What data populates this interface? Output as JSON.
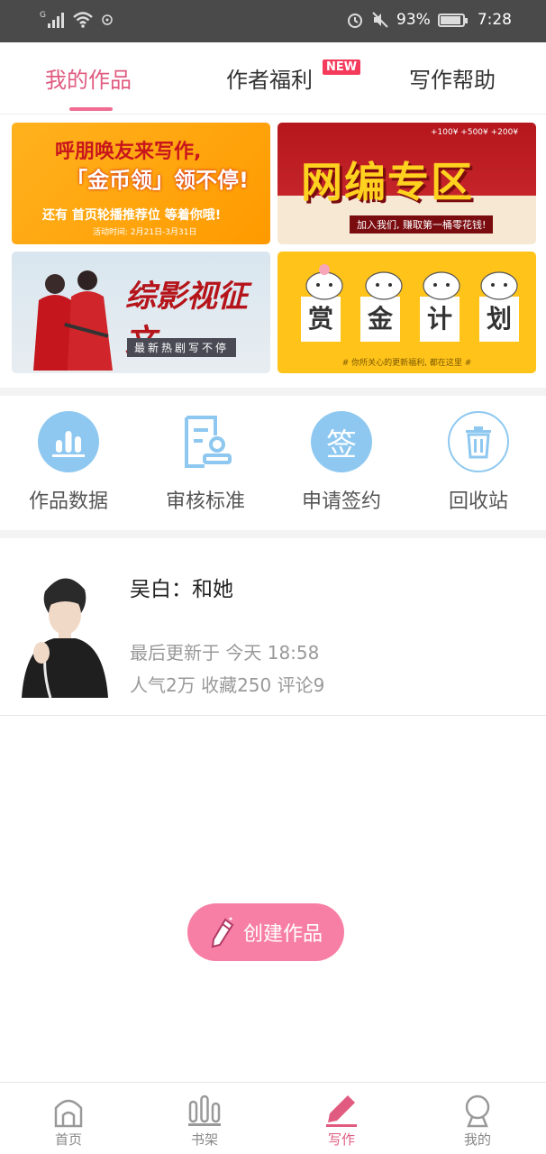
{
  "status_bar": {
    "network": "G",
    "battery": "93%",
    "time": "7:28"
  },
  "tabs": [
    {
      "label": "我的作品",
      "active": true
    },
    {
      "label": "作者福利",
      "badge": "NEW"
    },
    {
      "label": "写作帮助"
    }
  ],
  "banners": {
    "b1": {
      "line1": "呼朋唤友来写作,",
      "line2": "「金币领」领不停!",
      "line3": "还有 首页轮播推荐位 等着你哦!",
      "line4": "活动时间: 2月21日-3月31日"
    },
    "b2": {
      "title": "网编专区",
      "sub": "加入我们, 赚取第一桶零花钱!",
      "amounts": "+100¥  +500¥  +200¥"
    },
    "b3": {
      "title": "综影视征文",
      "sub": "最新热剧写不停"
    },
    "b4": {
      "chars": [
        "赏",
        "金",
        "计",
        "划"
      ],
      "sub": "# 你所关心的更新福利, 都在这里 #"
    }
  },
  "quick_actions": [
    {
      "label": "作品数据",
      "icon": "bar-chart-icon"
    },
    {
      "label": "审核标准",
      "icon": "review-document-icon"
    },
    {
      "label": "申请签约",
      "icon": "sign-icon",
      "glyph": "签"
    },
    {
      "label": "回收站",
      "icon": "trash-icon"
    }
  ],
  "work": {
    "title": "吴白：和她",
    "updated": "最后更新于 今天 18:58",
    "stats": "人气2万  收藏250  评论9"
  },
  "create_button": {
    "label": "创建作品"
  },
  "bottom_nav": [
    {
      "label": "首页",
      "icon": "home-icon"
    },
    {
      "label": "书架",
      "icon": "bookshelf-icon"
    },
    {
      "label": "写作",
      "icon": "pen-icon",
      "active": true
    },
    {
      "label": "我的",
      "icon": "profile-icon"
    }
  ],
  "colors": {
    "accent": "#e05b7f",
    "button": "#f77fa5",
    "icon_blue": "#8ec8f0"
  }
}
